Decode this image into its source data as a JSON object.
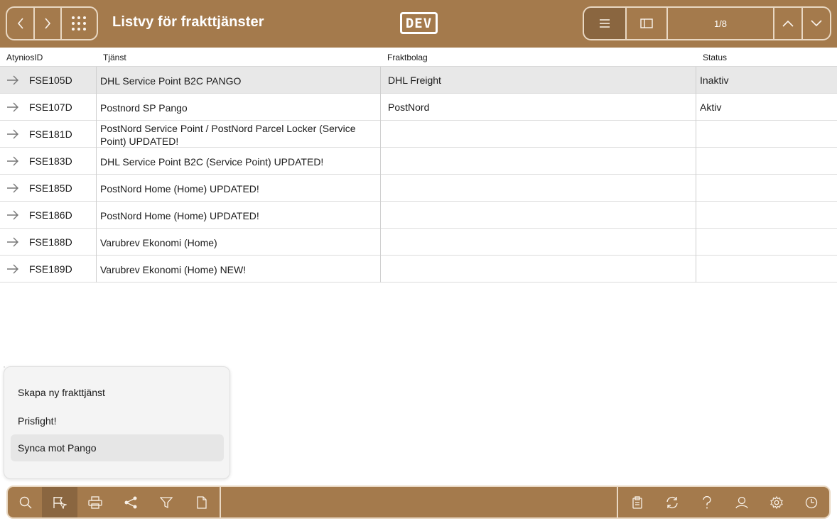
{
  "header": {
    "title": "Listvy för frakttjänster",
    "env_logo": "DEV",
    "record_counter": "1/8",
    "icons": [
      "chevron-left-icon",
      "chevron-right-icon",
      "grid-icon",
      "list-view-icon",
      "form-view-icon",
      "chevron-up-icon",
      "chevron-down-icon"
    ]
  },
  "table": {
    "columns": [
      "AtyniosID",
      "Tjänst",
      "Fraktbolag",
      "Status"
    ],
    "rows": [
      {
        "id": "FSE105D",
        "service": "DHL Service Point B2C PANGO",
        "carrier": "DHL Freight",
        "status": "Inaktiv"
      },
      {
        "id": "FSE107D",
        "service": "Postnord SP Pango",
        "carrier": "PostNord",
        "status": "Aktiv"
      },
      {
        "id": "FSE181D",
        "service": "PostNord Service Point / PostNord Parcel Locker (Service Point) UPDATED!",
        "carrier": "",
        "status": ""
      },
      {
        "id": "FSE183D",
        "service": "DHL Service Point B2C (Service Point) UPDATED!",
        "carrier": "",
        "status": ""
      },
      {
        "id": "FSE185D",
        "service": "PostNord Home (Home) UPDATED!",
        "carrier": "",
        "status": ""
      },
      {
        "id": "FSE186D",
        "service": "PostNord Home (Home) UPDATED!",
        "carrier": "",
        "status": ""
      },
      {
        "id": "FSE188D",
        "service": "Varubrev Ekonomi (Home)",
        "carrier": "",
        "status": ""
      },
      {
        "id": "FSE189D",
        "service": "Varubrev Ekonomi (Home) NEW!",
        "carrier": "",
        "status": ""
      }
    ]
  },
  "popup_menu": {
    "items": [
      "Skapa ny frakttjänst",
      "Prisfight!",
      "Synca mot Pango"
    ]
  },
  "toolbar": {
    "left_icons": [
      "search-icon",
      "action-flag-icon",
      "print-icon",
      "share-icon",
      "filter-icon",
      "document-icon"
    ],
    "right_icons": [
      "clipboard-icon",
      "sync-icon",
      "help-icon",
      "user-icon",
      "settings-icon",
      "history-icon"
    ]
  },
  "colors": {
    "bar_brown": "#a47a4c",
    "bar_brown_active": "#8a6640",
    "border_light": "#e9d8c3",
    "selected_row": "#e8e8e8"
  }
}
